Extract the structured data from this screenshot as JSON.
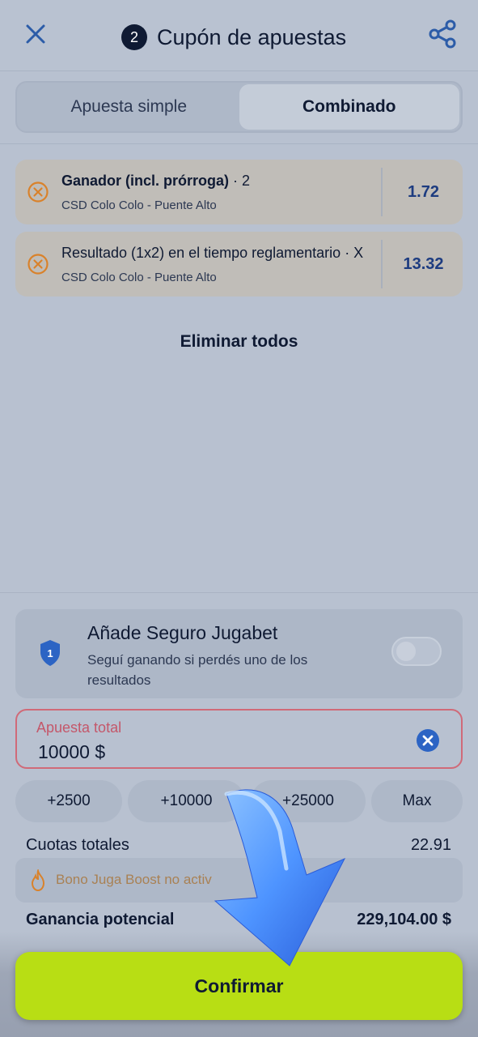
{
  "header": {
    "close_icon": "close-icon",
    "bet_count": "2",
    "title": "Cupón de apuestas",
    "share_icon": "share-icon"
  },
  "tabs": [
    {
      "label": "Apuesta simple",
      "active": false
    },
    {
      "label": "Combinado",
      "active": true
    }
  ],
  "bets": [
    {
      "market": "Ganador (incl. prórroga)",
      "selection": " · 2",
      "event": "CSD Colo Colo - Puente Alto",
      "odds": "1.72"
    },
    {
      "market": "Resultado (1x2) en el tiempo reglamentario",
      "selection": " · X",
      "event": "CSD Colo Colo - Puente Alto",
      "odds": "13.32"
    }
  ],
  "remove_all_label": "Eliminar todos",
  "insurance": {
    "badge_number": "1",
    "title": "Añade Seguro Jugabet",
    "description": "Seguí ganando si perdés uno de los resultados",
    "enabled": false
  },
  "stake": {
    "label": "Apuesta total",
    "value": "10000 $"
  },
  "quick_amounts": [
    "+2500",
    "+10000",
    "+25000",
    "Max"
  ],
  "summary": {
    "total_odds_label": "Cuotas totales",
    "total_odds_value": "22.91",
    "boost_text": "Bono Juga Boost no activ",
    "potential_win_label": "Ganancia potencial",
    "potential_win_value": "229,104.00 $"
  },
  "confirm_label": "Confirmar",
  "colors": {
    "accent": "#b8de14",
    "odds": "#1d3c80",
    "error": "#d06a78",
    "remove_icon": "#d9822b"
  }
}
